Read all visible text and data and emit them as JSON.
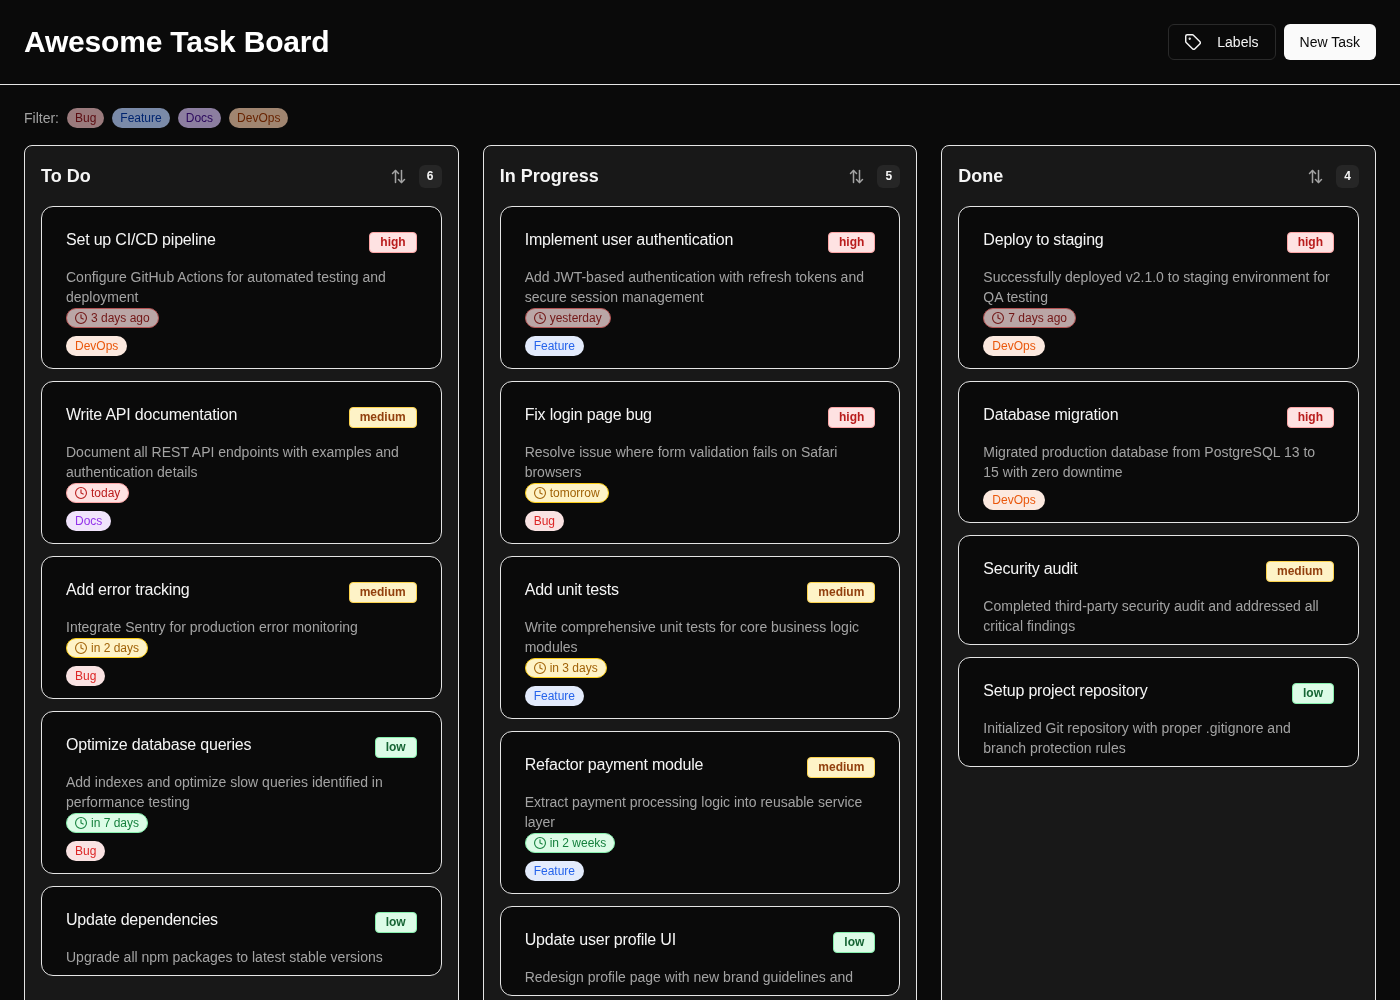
{
  "header": {
    "title": "Awesome Task Board",
    "buttons": [
      {
        "label": "Labels",
        "kind": "secondary"
      },
      {
        "label": "New Task",
        "kind": "primary"
      }
    ]
  },
  "filter": {
    "label": "Filter:",
    "chips": [
      {
        "label": "Bug",
        "color": "#9a7a7c",
        "selected": false
      },
      {
        "label": "Feature",
        "color": "#7a8aa8",
        "selected": false
      },
      {
        "label": "Docs",
        "color": "#8c7ea0",
        "selected": false
      },
      {
        "label": "DevOps",
        "color": "#a08570",
        "selected": false
      }
    ]
  },
  "columns": [
    {
      "title": "To Do",
      "count": "6",
      "cards": [
        {
          "title": "Set up CI/CD pipeline",
          "priority": {
            "text": "high",
            "kind": "high"
          },
          "description": "Configure GitHub Actions for automated testing and deployment",
          "due": {
            "text": "3 days ago",
            "kind": "overdue"
          },
          "tags": [
            {
              "label": "DevOps",
              "color": "#ea580c"
            }
          ]
        },
        {
          "title": "Write API documentation",
          "priority": {
            "text": "medium",
            "kind": "medium"
          },
          "description": "Document all REST API endpoints with examples and authentication details",
          "due": {
            "text": "today",
            "kind": "today"
          },
          "tags": [
            {
              "label": "Docs",
              "color": "#9333ea"
            }
          ]
        },
        {
          "title": "Add error tracking",
          "priority": {
            "text": "medium",
            "kind": "medium"
          },
          "description": "Integrate Sentry for production error monitoring",
          "due": {
            "text": "in 2 days",
            "kind": "soon"
          },
          "tags": [
            {
              "label": "Bug",
              "color": "#dc2626"
            }
          ]
        },
        {
          "title": "Optimize database queries",
          "priority": {
            "text": "low",
            "kind": "low"
          },
          "description": "Add indexes and optimize slow queries identified in performance testing",
          "due": {
            "text": "in 7 days",
            "kind": "later"
          },
          "tags": [
            {
              "label": "Bug",
              "color": "#dc2626"
            }
          ]
        },
        {
          "title": "Update dependencies",
          "priority": {
            "text": "low",
            "kind": "low"
          },
          "description": "Upgrade all npm packages to latest stable versions"
        }
      ]
    },
    {
      "title": "In Progress",
      "count": "5",
      "cards": [
        {
          "title": "Implement user authentication",
          "priority": {
            "text": "high",
            "kind": "high"
          },
          "description": "Add JWT-based authentication with refresh tokens and secure session management",
          "due": {
            "text": "yesterday",
            "kind": "overdue"
          },
          "tags": [
            {
              "label": "Feature",
              "color": "#2563eb"
            }
          ]
        },
        {
          "title": "Fix login page bug",
          "priority": {
            "text": "high",
            "kind": "high"
          },
          "description": "Resolve issue where form validation fails on Safari browsers",
          "due": {
            "text": "tomorrow",
            "kind": "soon"
          },
          "tags": [
            {
              "label": "Bug",
              "color": "#dc2626"
            }
          ]
        },
        {
          "title": "Add unit tests",
          "priority": {
            "text": "medium",
            "kind": "medium"
          },
          "description": "Write comprehensive unit tests for core business logic modules",
          "due": {
            "text": "in 3 days",
            "kind": "soon"
          },
          "tags": [
            {
              "label": "Feature",
              "color": "#2563eb"
            }
          ]
        },
        {
          "title": "Refactor payment module",
          "priority": {
            "text": "medium",
            "kind": "medium"
          },
          "description": "Extract payment processing logic into reusable service layer",
          "due": {
            "text": "in 2 weeks",
            "kind": "later"
          },
          "tags": [
            {
              "label": "Feature",
              "color": "#2563eb"
            }
          ]
        },
        {
          "title": "Update user profile UI",
          "priority": {
            "text": "low",
            "kind": "low"
          },
          "description": "Redesign profile page with new brand guidelines and"
        }
      ]
    },
    {
      "title": "Done",
      "count": "4",
      "cards": [
        {
          "title": "Deploy to staging",
          "priority": {
            "text": "high",
            "kind": "high"
          },
          "description": "Successfully deployed v2.1.0 to staging environment for QA testing",
          "due": {
            "text": "7 days ago",
            "kind": "overdue"
          },
          "tags": [
            {
              "label": "DevOps",
              "color": "#ea580c"
            }
          ]
        },
        {
          "title": "Database migration",
          "priority": {
            "text": "high",
            "kind": "high"
          },
          "description": "Migrated production database from PostgreSQL 13 to 15 with zero downtime",
          "tags": [
            {
              "label": "DevOps",
              "color": "#ea580c"
            }
          ]
        },
        {
          "title": "Security audit",
          "priority": {
            "text": "medium",
            "kind": "medium"
          },
          "description": "Completed third-party security audit and addressed all critical findings"
        },
        {
          "title": "Setup project repository",
          "priority": {
            "text": "low",
            "kind": "low"
          },
          "description": "Initialized Git repository with proper .gitignore and branch protection rules"
        }
      ]
    }
  ]
}
